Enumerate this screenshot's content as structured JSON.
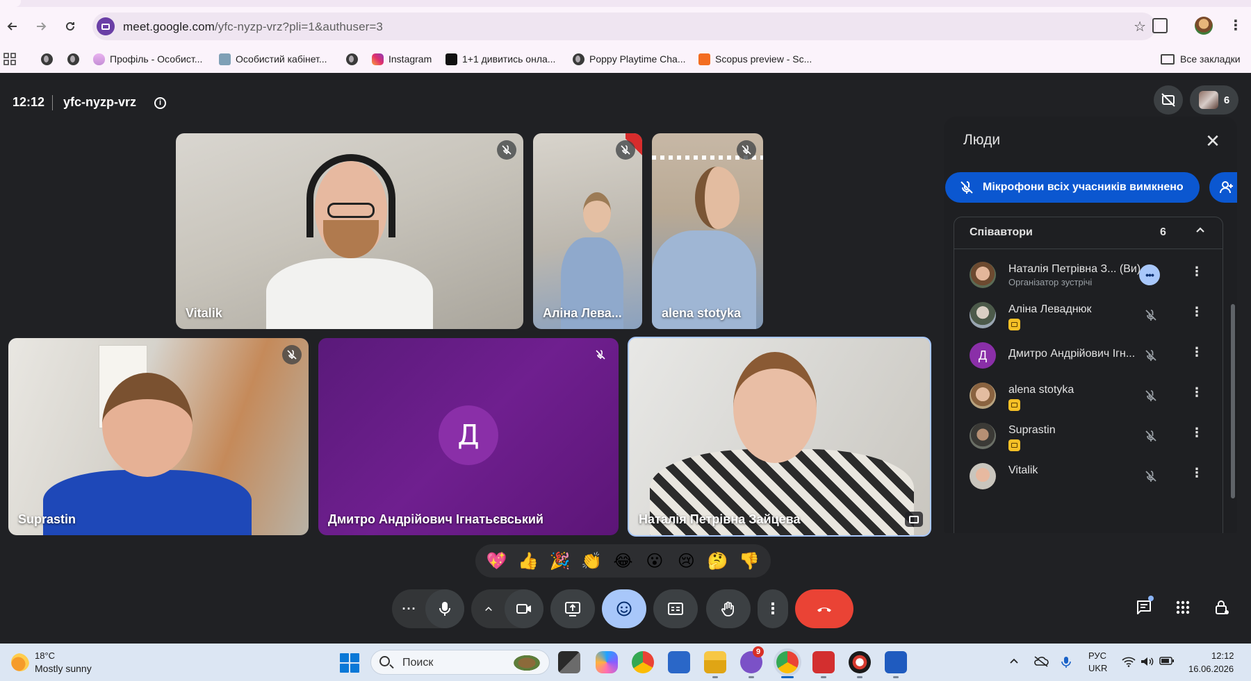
{
  "browser": {
    "url_main": "meet.google.com",
    "url_rest": "/yfc-nyzp-vrz?pli=1&authuser=3",
    "bookmarks": [
      {
        "label": "Профіль - Особист...",
        "icon": "cloud-icon"
      },
      {
        "label": "Особистий кабінет...",
        "icon": "portal-icon"
      },
      {
        "label": "Instagram",
        "icon": "instagram-icon"
      },
      {
        "label": "1+1 дивитись онла...",
        "icon": "video-icon"
      },
      {
        "label": "Poppy Playtime Cha...",
        "icon": "globe-icon"
      },
      {
        "label": "Scopus preview - Sc...",
        "icon": "scopus-icon"
      }
    ],
    "all_bookmarks": "Все закладки"
  },
  "meet": {
    "time": "12:12",
    "code": "yfc-nyzp-vrz",
    "people_count": "6",
    "tiles": {
      "vitalik": "Vitalik",
      "alina": "Аліна Лева...",
      "alena": "alena stotyka",
      "suprastin": "Suprastin",
      "dmytro": "Дмитро Андрійович Ігнатьєвський",
      "dmytro_initial": "Д",
      "natalia": "Наталія Петрівна Зайцева"
    },
    "reactions": [
      "💖",
      "👍",
      "🎉",
      "👏",
      "😂",
      "😮",
      "😢",
      "🤔",
      "👎"
    ]
  },
  "panel": {
    "title": "Люди",
    "mute_all": "Мікрофони всіх учасників вимкнено",
    "section_title": "Співавтори",
    "section_count": "6",
    "participants": [
      {
        "name": "Наталія Петрівна З... (Ви)",
        "role": "Організатор зустрічі"
      },
      {
        "name": "Аліна Леваднюк"
      },
      {
        "name": "Дмитро Андрійович Ігн...",
        "initial": "Д"
      },
      {
        "name": "alena stotyka"
      },
      {
        "name": "Suprastin"
      },
      {
        "name": "Vitalik"
      }
    ]
  },
  "taskbar": {
    "temp": "18°C",
    "weather": "Mostly sunny",
    "search_placeholder": "Поиск",
    "viber_badge": "9",
    "lang_top": "РУС",
    "lang_bottom": "UKR",
    "clock_time": "12:12",
    "clock_date": "16.06.2026"
  },
  "colors": {
    "meet_bg": "#202124",
    "accent_blue": "#0b57d0",
    "hangup_red": "#ea4335",
    "active_control": "#a8c7fa"
  }
}
